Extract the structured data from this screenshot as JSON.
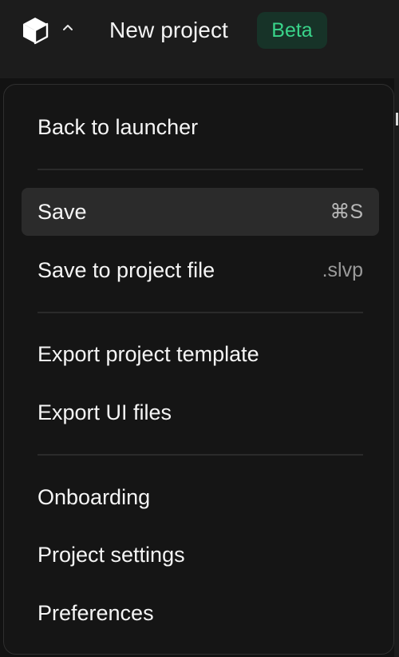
{
  "header": {
    "title": "New project",
    "badge": "Beta",
    "logo_icon": "cube-logo-icon",
    "menu_toggle_icon": "chevron-up-icon"
  },
  "menu": {
    "items": [
      {
        "label": "Back to launcher",
        "shortcut": ""
      },
      {
        "label": "Save",
        "shortcut": "⌘S",
        "highlighted": true
      },
      {
        "label": "Save to project file",
        "shortcut": ".slvp"
      },
      {
        "label": "Export project template",
        "shortcut": ""
      },
      {
        "label": "Export UI files",
        "shortcut": ""
      },
      {
        "label": "Onboarding",
        "shortcut": ""
      },
      {
        "label": "Project settings",
        "shortcut": ""
      },
      {
        "label": "Preferences",
        "shortcut": ""
      }
    ]
  },
  "colors": {
    "badge_text": "#39d48a",
    "badge_bg": "#173328",
    "menu_bg": "#151515",
    "highlight_bg": "#2b2b2b"
  }
}
